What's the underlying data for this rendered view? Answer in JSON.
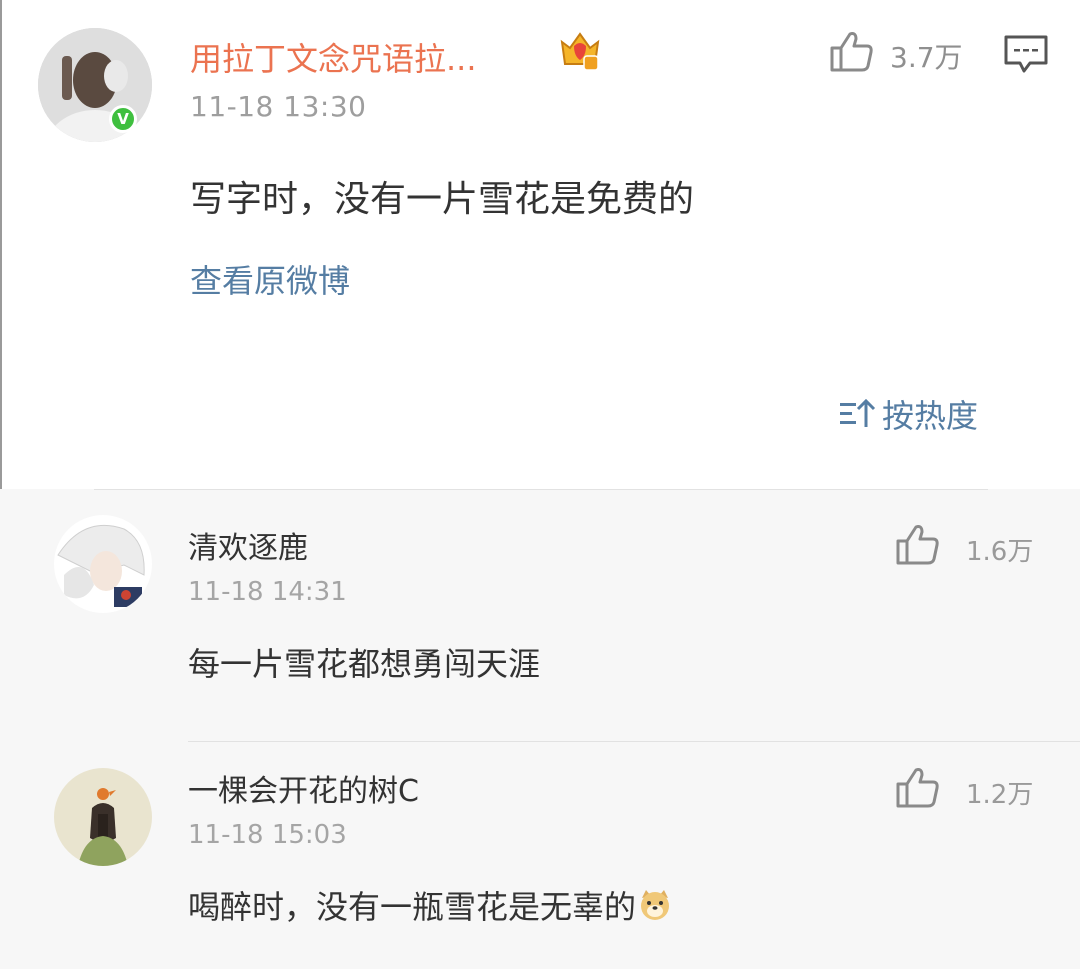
{
  "post": {
    "username": "用拉丁文念咒语拉...",
    "timestamp": "11-18 13:30",
    "likes": "3.7万",
    "content": "写字时，没有一片雪花是免费的",
    "view_original": "查看原微博",
    "verified_badge": "V",
    "icons": {
      "like": "like-icon",
      "comment": "comment-icon",
      "crown": "crown-badge-icon"
    },
    "accent_color": "#eb7350"
  },
  "sort": {
    "label": "按热度",
    "icon": "sort-icon"
  },
  "replies": [
    {
      "username": "清欢逐鹿",
      "timestamp": "11-18 14:31",
      "likes": "1.6万",
      "content": "每一片雪花都想勇闯天涯"
    },
    {
      "username": "一棵会开花的树C",
      "timestamp": "11-18 15:03",
      "likes": "1.2万",
      "content": "喝醉时，没有一瓶雪花是无辜的",
      "emoji": "doge-emoji"
    }
  ],
  "colors": {
    "link": "#557da3",
    "muted": "#9e9e9e",
    "reply_bg": "#f7f7f7"
  }
}
